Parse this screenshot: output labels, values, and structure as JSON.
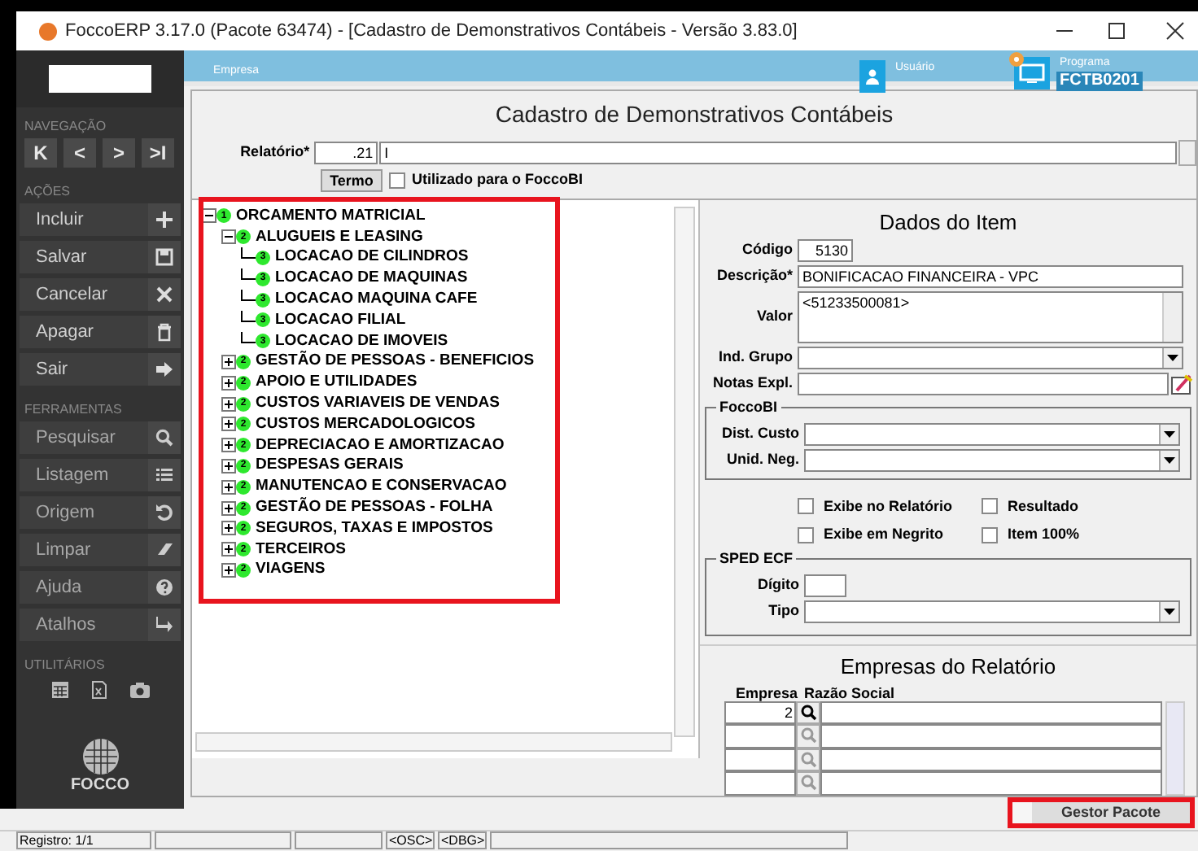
{
  "window": {
    "title": "FoccoERP 3.17.0 (Pacote 63474) - [Cadastro de Demonstrativos Contábeis - Versão 3.83.0]"
  },
  "header": {
    "company_label": "Empresa",
    "user_label": "Usuário",
    "program_label": "Programa",
    "program_code": "FCTB0201"
  },
  "sidebar": {
    "sections": [
      {
        "title": "NAVEGAÇÃO",
        "kind": "nav",
        "nav": [
          "K",
          "<",
          ">",
          ">I"
        ]
      },
      {
        "title": "AÇÕES",
        "kind": "buttons",
        "items": [
          "Incluir",
          "Salvar",
          "Cancelar",
          "Apagar",
          "Sair"
        ]
      },
      {
        "title": "FERRAMENTAS",
        "kind": "buttons",
        "items": [
          "Pesquisar",
          "Listagem",
          "Origem",
          "Limpar",
          "Ajuda",
          "Atalhos"
        ]
      },
      {
        "title": "UTILITÁRIOS",
        "kind": "tools"
      }
    ],
    "logo": "FOCCO"
  },
  "form": {
    "title": "Cadastro de Demonstrativos Contábeis",
    "report_label": "Relatório*",
    "report_code": ".21",
    "report_name": "I",
    "term_button": "Termo",
    "focco_bi_checkbox": {
      "label": "Utilizado para o FoccoBI",
      "checked": false
    }
  },
  "tree": [
    {
      "label": "ORCAMENTO MATRICIAL",
      "badge": "1",
      "expanded": true,
      "children": [
        {
          "label": "ALUGUEIS E LEASING",
          "badge": "2",
          "expanded": true,
          "children": [
            {
              "label": "LOCACAO DE CILINDROS",
              "badge": "3"
            },
            {
              "label": "LOCACAO DE MAQUINAS",
              "badge": "3"
            },
            {
              "label": "LOCACAO MAQUINA CAFE",
              "badge": "3"
            },
            {
              "label": "LOCACAO FILIAL",
              "badge": "3"
            },
            {
              "label": "LOCACAO DE IMOVEIS",
              "badge": "3"
            }
          ]
        },
        {
          "label": "GESTÃO DE PESSOAS - BENEFICIOS",
          "badge": "2",
          "expanded": false
        },
        {
          "label": "APOIO E UTILIDADES",
          "badge": "2",
          "expanded": false
        },
        {
          "label": "CUSTOS VARIAVEIS DE VENDAS",
          "badge": "2",
          "expanded": false
        },
        {
          "label": "CUSTOS MERCADOLOGICOS",
          "badge": "2",
          "expanded": false
        },
        {
          "label": "DEPRECIACAO E AMORTIZACAO",
          "badge": "2",
          "expanded": false
        },
        {
          "label": "DESPESAS GERAIS",
          "badge": "2",
          "expanded": false
        },
        {
          "label": "MANUTENCAO E CONSERVACAO",
          "badge": "2",
          "expanded": false
        },
        {
          "label": "GESTÃO DE PESSOAS - FOLHA",
          "badge": "2",
          "expanded": false
        },
        {
          "label": "SEGUROS, TAXAS E IMPOSTOS",
          "badge": "2",
          "expanded": false
        },
        {
          "label": "TERCEIROS",
          "badge": "2",
          "expanded": false
        },
        {
          "label": "VIAGENS",
          "badge": "2",
          "expanded": false
        }
      ]
    }
  ],
  "item": {
    "title": "Dados do Item",
    "code_label": "Código",
    "code": "5130",
    "description_label": "Descrição*",
    "description": "BONIFICACAO FINANCEIRA - VPC",
    "value_label": "Valor",
    "value": "<51233500081>",
    "group_label": "Ind. Grupo",
    "notes_label": "Notas Expl.",
    "focco_bi": {
      "title": "FoccoBI",
      "cost_label": "Dist. Custo",
      "unit_label": "Unid. Neg."
    },
    "checkboxes": [
      {
        "label": "Exibe no Relatório",
        "checked": false
      },
      {
        "label": "Resultado",
        "checked": false
      },
      {
        "label": "Exibe em Negrito",
        "checked": false
      },
      {
        "label": "Item 100%",
        "checked": false
      }
    ],
    "sped": {
      "title": "SPED ECF",
      "digit_label": "Dígito",
      "type_label": "Tipo"
    }
  },
  "companies": {
    "title": "Empresas do Relatório",
    "columns": [
      "Empresa",
      "Razão Social"
    ],
    "rows": [
      {
        "company": "2"
      },
      {},
      {},
      {}
    ]
  },
  "gestor_button": "Gestor Pacote",
  "status_bar": [
    "Registro: 1/1",
    "<OSC>",
    "<DBG>"
  ]
}
